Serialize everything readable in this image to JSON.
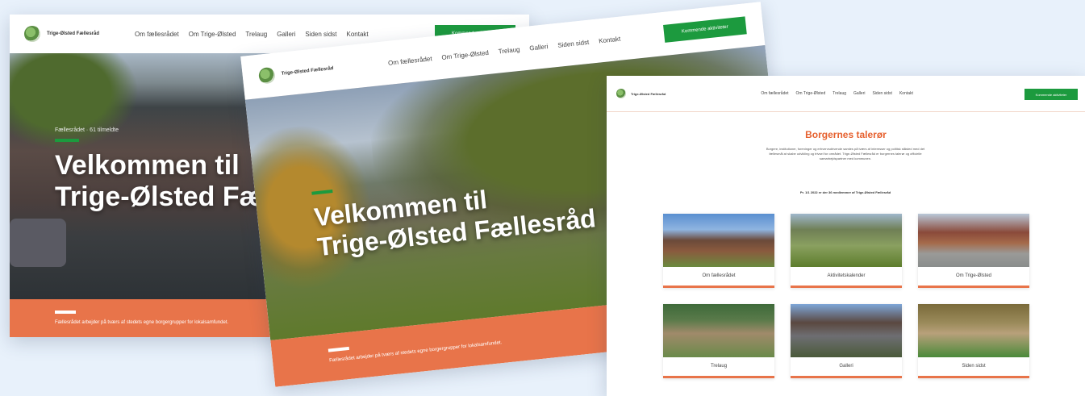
{
  "site": {
    "brand": "Trige-Ølsted Fællesråd",
    "nav": [
      "Om fællesrådet",
      "Om Trige-Ølsted",
      "Trelaug",
      "Galleri",
      "Siden sidst",
      "Kontakt"
    ],
    "cta": "Kommende aktiviteter",
    "hero_title_line1": "Velkommen til",
    "hero_title_line2a": "Trige-Ølsted Fæl",
    "hero_title_line2b": "Trige-Ølsted Fællesråd",
    "breadcrumb": "Fællesrådet · 61 tilmeldte",
    "band_text": "Fællesrådet arbejder på tværs af stedets egne borgergrupper for lokalsamfundet."
  },
  "section": {
    "title": "Borgernes talerør",
    "body": "Borgere, institutioner, foreninger og erhvervsdrivende samles på tværs af interesser og politisk ståsted med det fællesmål at skabe udvikling og trivsel for området. Trige-Ølsted Fællesråd er borgernes talerør og officielle samarbejdspartner med kommunen.",
    "note": "Pr. 1/1 2022 er der 36 medlemmer af Trige-Ølsted Fællesråd",
    "tiles": [
      {
        "label": "Om fællesrådet"
      },
      {
        "label": "Aktivitetskalender"
      },
      {
        "label": "Om Trige-Ølsted"
      },
      {
        "label": "Trelaug"
      },
      {
        "label": "Galleri"
      },
      {
        "label": "Siden sidst"
      }
    ]
  },
  "colors": {
    "accent_orange": "#e8744a",
    "cta_green": "#1c9a3e",
    "title_orange": "#e6612f",
    "background": "#e8f1fb"
  }
}
